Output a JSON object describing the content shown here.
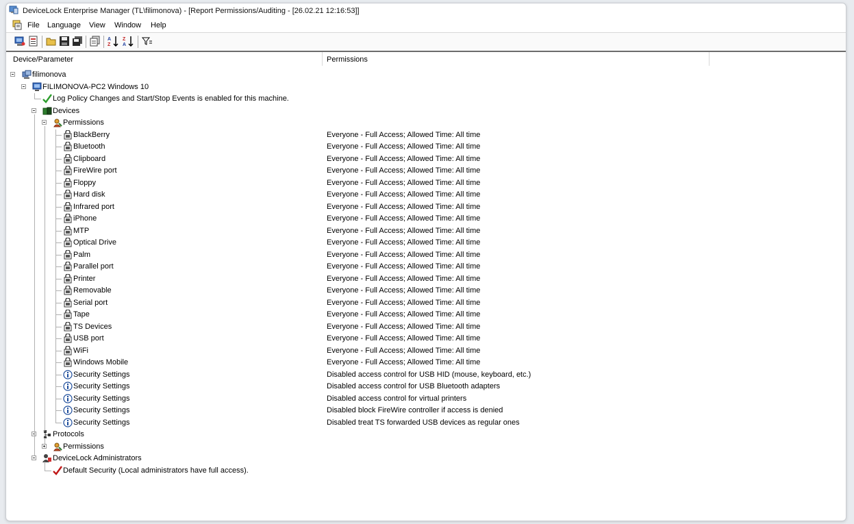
{
  "window": {
    "title": "DeviceLock Enterprise Manager (TL\\filimonova) - [Report Permissions/Auditing - [26.02.21 12:16:53]]"
  },
  "menu": [
    "File",
    "Language",
    "View",
    "Window",
    "Help"
  ],
  "toolbar": {
    "buttons": [
      "scan-network-icon",
      "report-icon",
      "open-icon",
      "save-icon",
      "save-all-icon",
      "copy-icon",
      "sort-ascending-icon",
      "sort-descending-icon",
      "filter-icon"
    ]
  },
  "columns": {
    "device": "Device/Parameter",
    "permissions": "Permissions"
  },
  "tree": {
    "root": "filimonova",
    "computer": "FILIMONOVA-PC2 Windows 10",
    "log_policy": "Log Policy Changes and Start/Stop Events is enabled for this machine.",
    "devices": "Devices",
    "permissions": "Permissions",
    "device_items": [
      {
        "name": "BlackBerry",
        "perm": "Everyone - Full Access; Allowed Time: All time"
      },
      {
        "name": "Bluetooth",
        "perm": "Everyone - Full Access; Allowed Time: All time"
      },
      {
        "name": "Clipboard",
        "perm": "Everyone - Full Access; Allowed Time: All time"
      },
      {
        "name": "FireWire port",
        "perm": "Everyone - Full Access; Allowed Time: All time"
      },
      {
        "name": "Floppy",
        "perm": "Everyone - Full Access; Allowed Time: All time"
      },
      {
        "name": "Hard disk",
        "perm": "Everyone - Full Access; Allowed Time: All time"
      },
      {
        "name": "Infrared port",
        "perm": "Everyone - Full Access; Allowed Time: All time"
      },
      {
        "name": "iPhone",
        "perm": "Everyone - Full Access; Allowed Time: All time"
      },
      {
        "name": "MTP",
        "perm": "Everyone - Full Access; Allowed Time: All time"
      },
      {
        "name": "Optical Drive",
        "perm": "Everyone - Full Access; Allowed Time: All time"
      },
      {
        "name": "Palm",
        "perm": "Everyone - Full Access; Allowed Time: All time"
      },
      {
        "name": "Parallel port",
        "perm": "Everyone - Full Access; Allowed Time: All time"
      },
      {
        "name": "Printer",
        "perm": "Everyone - Full Access; Allowed Time: All time"
      },
      {
        "name": "Removable",
        "perm": "Everyone - Full Access; Allowed Time: All time"
      },
      {
        "name": "Serial port",
        "perm": "Everyone - Full Access; Allowed Time: All time"
      },
      {
        "name": "Tape",
        "perm": "Everyone - Full Access; Allowed Time: All time"
      },
      {
        "name": "TS Devices",
        "perm": "Everyone - Full Access; Allowed Time: All time"
      },
      {
        "name": "USB port",
        "perm": "Everyone - Full Access; Allowed Time: All time"
      },
      {
        "name": "WiFi",
        "perm": "Everyone - Full Access; Allowed Time: All time"
      },
      {
        "name": "Windows Mobile",
        "perm": "Everyone - Full Access; Allowed Time: All time"
      }
    ],
    "security_items": [
      {
        "name": "Security Settings",
        "perm": "Disabled access control for USB HID (mouse, keyboard, etc.)"
      },
      {
        "name": "Security Settings",
        "perm": "Disabled access control for USB Bluetooth adapters"
      },
      {
        "name": "Security Settings",
        "perm": "Disabled access control for virtual printers"
      },
      {
        "name": "Security Settings",
        "perm": "Disabled block FireWire controller if access is denied"
      },
      {
        "name": "Security Settings",
        "perm": "Disabled treat TS forwarded USB devices as regular ones"
      }
    ],
    "protocols": "Protocols",
    "protocols_permissions": "Permissions",
    "administrators": "DeviceLock Administrators",
    "default_security": "Default Security (Local administrators have full access)."
  },
  "colors": {
    "check_green": "#2e9e2e",
    "check_red": "#c01818"
  }
}
